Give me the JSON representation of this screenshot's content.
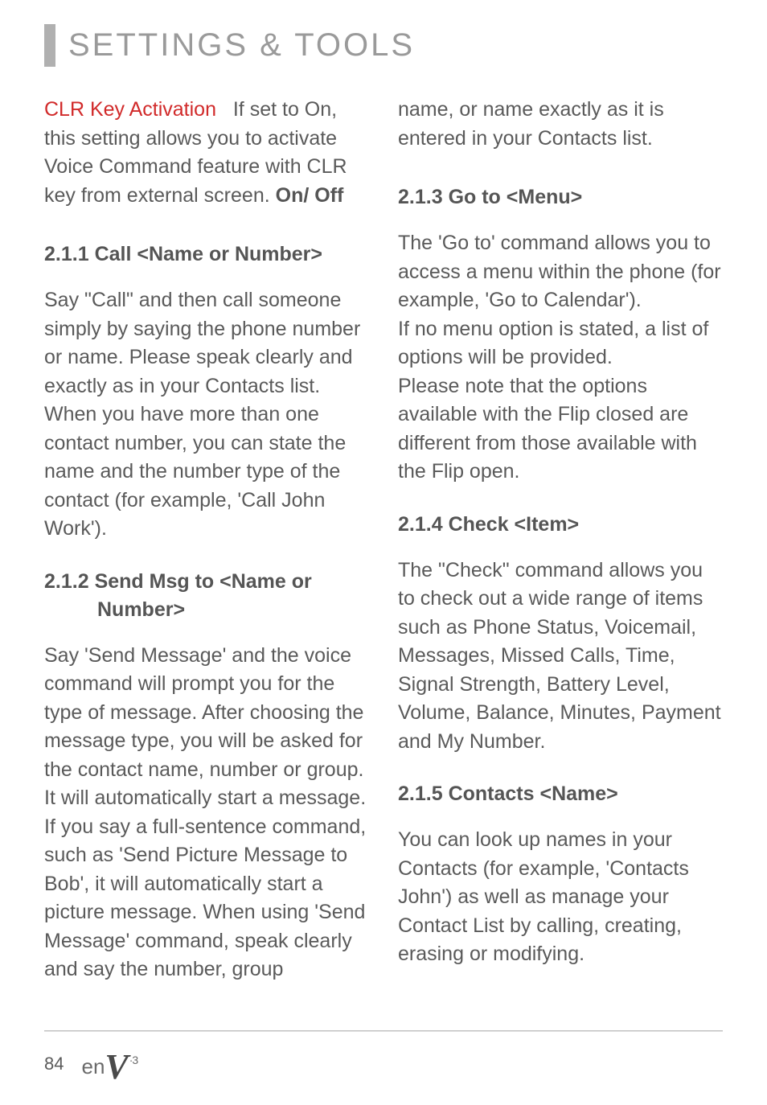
{
  "header": {
    "title": "SETTINGS & TOOLS"
  },
  "left": {
    "clr_para": {
      "red": "CLR Key Activation",
      "text_1": "If set to On, this setting allows you to activate Voice Command feature with CLR key from external screen. ",
      "bold_tail": "On/ Off"
    },
    "s211": {
      "num": "2.1.1",
      "title": "Call <Name or Number>",
      "body": "Say \"Call\" and then call someone simply by saying the phone number or name. Please speak clearly and exactly as in your Contacts list. When you have more than one contact number, you can state the name and the number type of the contact (for example, 'Call John Work')."
    },
    "s212": {
      "num": "2.1.2",
      "title_line1": "Send Msg to <Name or",
      "title_line2": "Number>",
      "body": "Say 'Send Message' and the voice command will prompt you for the type of message. After choosing the message type, you will be asked for the contact name, number or group. It will automatically start a message. If you say a full-sentence command, such as 'Send Picture Message to Bob', it will automatically start a picture message. When using 'Send Message' command, speak clearly and say the number, group"
    }
  },
  "right": {
    "cont_para": "name, or name exactly as it is entered in your Contacts list.",
    "s213": {
      "num": "2.1.3",
      "title": "Go to <Menu>",
      "body1": "The 'Go to' command allows you to access a menu within the phone (for example, 'Go to Calendar').",
      "body2": "If no menu option is stated, a list of options will be provided.",
      "body3": "Please note that the options available with the Flip closed are different from those available with the Flip open."
    },
    "s214": {
      "num": "2.1.4",
      "title": "Check <Item>",
      "body": "The \"Check\" command allows you to check out a wide range of items such as Phone Status, Voicemail, Messages, Missed Calls, Time, Signal Strength, Battery Level, Volume, Balance, Minutes, Payment and My Number."
    },
    "s215": {
      "num": "2.1.5",
      "title": "Contacts <Name>",
      "body": "You can look up names in your Contacts (for example, 'Contacts John') as well as manage your Contact List by calling, creating, erasing or modifying."
    }
  },
  "footer": {
    "page": "84",
    "logo_en": "en",
    "logo_v": "V",
    "logo_3": "·3"
  }
}
